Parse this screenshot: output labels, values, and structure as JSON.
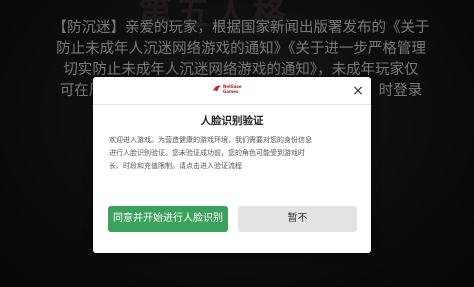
{
  "background": {
    "logo_text": "第五人格",
    "notice_lines": [
      "【防沉迷】亲爱的玩家，根据国家新闻出版署发布的《关于",
      "防止未成年人沉迷网络游戏的通知》《关于进一步严格管理",
      "切实防止未成年人沉迷网络游戏的通知》，未成年玩家仅",
      "可在周　　　　　　　　　　　　　　　　　　　时登录"
    ]
  },
  "dialog": {
    "brand_text": "NetEase\nGames",
    "close_glyph": "×",
    "title": "人脸识别验证",
    "description_lines": [
      "欢迎进入游戏。为营造健康的游戏环境，我们需要对您的身份信息",
      "进行人脸识别验证。您未验证成功前，您的角色可能受到游戏时",
      "长、时段和充值限制。请点击进入验证流程"
    ],
    "agree_button": "同意并开始进行人脸识别",
    "later_button": "暂不"
  },
  "colors": {
    "agree": "#3aa25c",
    "later": "#e3e3e3",
    "brand": "#b02020"
  }
}
